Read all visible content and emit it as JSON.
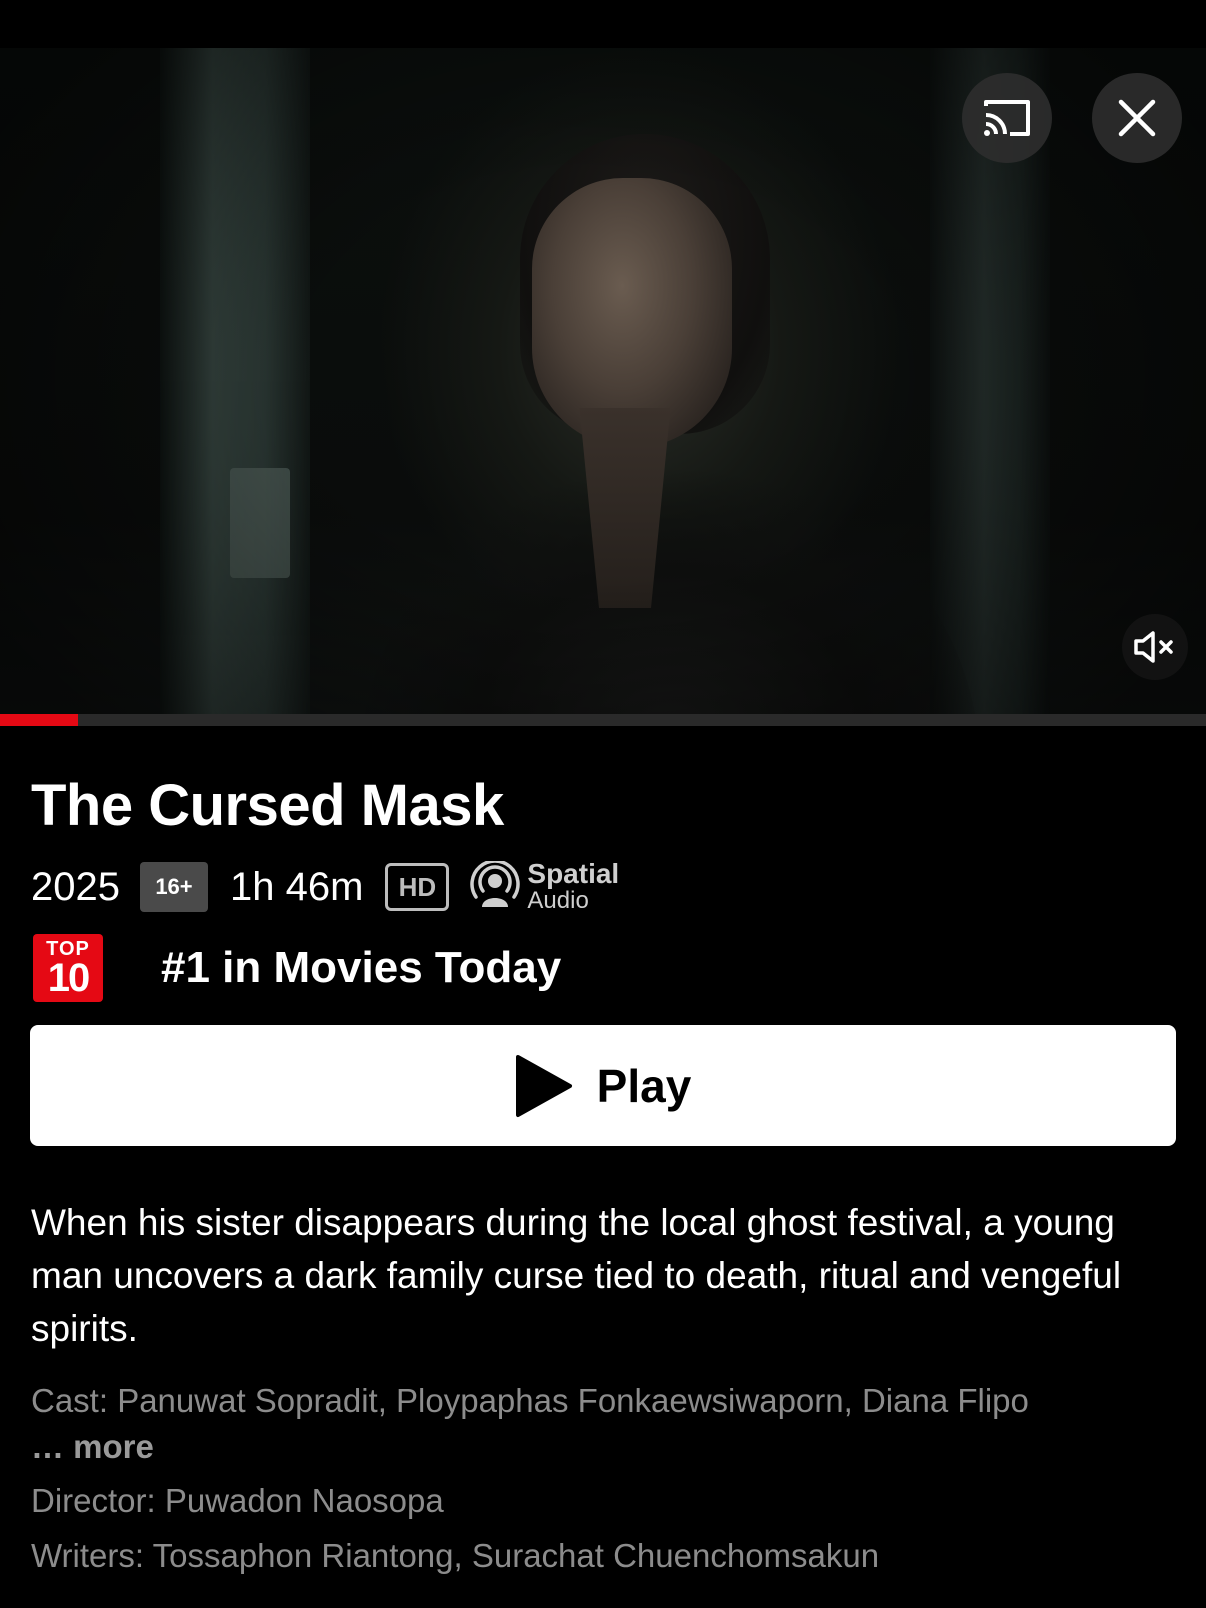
{
  "player": {
    "progress_fraction": 0.065,
    "accent_color": "#e50914",
    "cast_icon": "cast-icon",
    "close_icon": "close-icon",
    "mute_icon": "muted-speaker-icon"
  },
  "title": {
    "name": "The Cursed Mask",
    "year": "2025",
    "maturity_rating": "16+",
    "duration": "1h 46m",
    "quality": "HD",
    "audio_line1": "Spatial",
    "audio_line2": "Audio"
  },
  "ranking": {
    "badge_top": "TOP",
    "badge_num": "10",
    "text": "#1 in Movies Today"
  },
  "play_button": {
    "label": "Play",
    "icon": "play-icon"
  },
  "synopsis": "When his sister disappears during the local ghost festival, a young man uncovers a dark family curse tied to death, ritual and vengeful spirits.",
  "credits": {
    "cast": "Cast: Panuwat Sopradit, Ploypaphas Fonkaewsiwaporn, Diana Flipo",
    "more": "… more",
    "director": "Director: Puwadon Naosopa",
    "writers": "Writers: Tossaphon Riantong, Surachat Chuenchomsakun"
  }
}
